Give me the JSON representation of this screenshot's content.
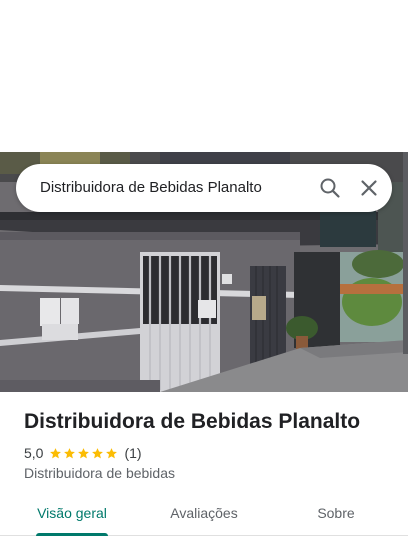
{
  "search": {
    "value": "Distribuidora de Bebidas Planalto"
  },
  "place": {
    "title": "Distribuidora de Bebidas Planalto",
    "rating": "5,0",
    "stars": 5,
    "review_count": "(1)",
    "category": "Distribuidora de bebidas"
  },
  "tabs": [
    {
      "label": "Visão geral",
      "active": true
    },
    {
      "label": "Avaliações",
      "active": false
    },
    {
      "label": "Sobre",
      "active": false
    }
  ],
  "colors": {
    "accent": "#00796b",
    "star": "#fbbc04",
    "text_primary": "#202124",
    "text_secondary": "#5f6368"
  },
  "icons": {
    "search": "search-icon",
    "close": "close-icon",
    "star": "star-icon"
  }
}
